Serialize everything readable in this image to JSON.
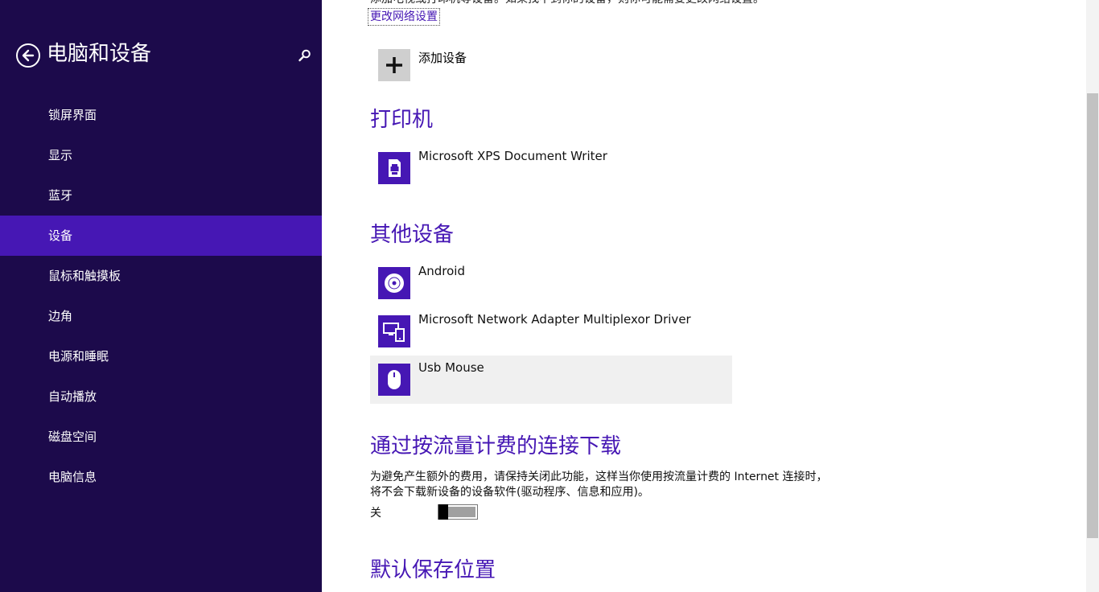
{
  "nav": {
    "title": "电脑和设备",
    "back_icon": "back-arrow-icon",
    "search_icon": "search-icon",
    "items": [
      {
        "label": "锁屏界面"
      },
      {
        "label": "显示"
      },
      {
        "label": "蓝牙"
      },
      {
        "label": "设备",
        "selected": true
      },
      {
        "label": "鼠标和触摸板"
      },
      {
        "label": "边角"
      },
      {
        "label": "电源和睡眠"
      },
      {
        "label": "自动播放"
      },
      {
        "label": "磁盘空间"
      },
      {
        "label": "电脑信息"
      }
    ]
  },
  "main": {
    "intro_text": "添加电视或打印机等设备。如果找不到你的设备，则你可能需要更改网络设置。",
    "change_network_link": "更改网络设置",
    "add_device": {
      "icon": "plus-icon",
      "label": "添加设备"
    },
    "printers": {
      "title": "打印机",
      "devices": [
        {
          "label": "Microsoft XPS Document Writer",
          "icon": "printer-icon"
        }
      ]
    },
    "other_devices": {
      "title": "其他设备",
      "devices": [
        {
          "label": "Android",
          "icon": "disc-icon"
        },
        {
          "label": "Microsoft Network Adapter Multiplexor Driver",
          "icon": "network-devices-icon"
        },
        {
          "label": "Usb Mouse",
          "icon": "mouse-icon"
        }
      ]
    },
    "metered": {
      "title": "通过按流量计费的连接下载",
      "desc_line1": "为避免产生额外的费用，请保持关闭此功能，这样当你使用按流量计费的 Internet 连接时，",
      "desc_line2": "将不会下载新设备的设备软件(驱动程序、信息和应用)。",
      "toggle_label": "关",
      "toggle_on": false
    },
    "default_save": {
      "title": "默认保存位置"
    }
  },
  "colors": {
    "nav_bg": "#1c0a4b",
    "nav_selected": "#4617b4",
    "accent": "#4617b4",
    "hover_row": "#f0f0f0"
  }
}
